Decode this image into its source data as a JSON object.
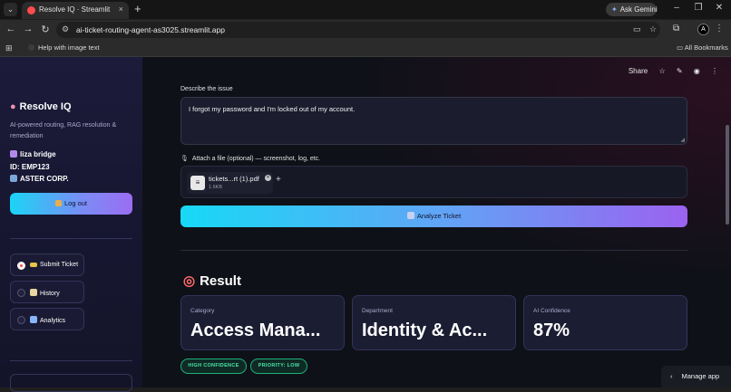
{
  "browser": {
    "tab_title": "Resolve IQ · Streamlit",
    "tab_close": "×",
    "new_tab": "+",
    "ask_gemini": "Ask Gemini",
    "url": "ai-ticket-routing-agent-as3025.streamlit.app",
    "bookmark_item": "Help with image text",
    "all_bookmarks": "All Bookmarks",
    "profile_initial": "A"
  },
  "sidebar": {
    "app_title": "Resolve IQ",
    "subtitle": "AI-powered routing, RAG resolution & remediation",
    "user_name": "liza bridge",
    "user_id": "ID: EMP123",
    "org": "ASTER CORP.",
    "logout_label": "Log out",
    "nav": [
      {
        "label": "Submit Ticket",
        "active": true
      },
      {
        "label": "History",
        "active": false
      },
      {
        "label": "Analytics",
        "active": false
      }
    ]
  },
  "topbar": {
    "share": "Share"
  },
  "form": {
    "issue_label": "Describe the issue",
    "issue_text": "I forgot my password and I'm locked out of my account.",
    "attach_label": "Attach a file (optional) — screenshot, log, etc.",
    "file_name": "tickets...rt (1).pdf",
    "file_size": "1.6KB",
    "analyze_label": "Analyze Ticket"
  },
  "result": {
    "heading": "Result",
    "cards": [
      {
        "label": "Category",
        "value": "Access Mana..."
      },
      {
        "label": "Department",
        "value": "Identity & Ac..."
      },
      {
        "label": "AI Confidence",
        "value": "87%"
      }
    ],
    "badges": [
      "HIGH CONFIDENCE",
      "PRIORITY: LOW"
    ]
  },
  "footer": {
    "manage_app": "Manage app"
  },
  "colors": {
    "accent_start": "#17d9f6",
    "accent_end": "#9b62f0",
    "badge_green": "#4be3a8",
    "active_radio": "#ff4b4b"
  }
}
